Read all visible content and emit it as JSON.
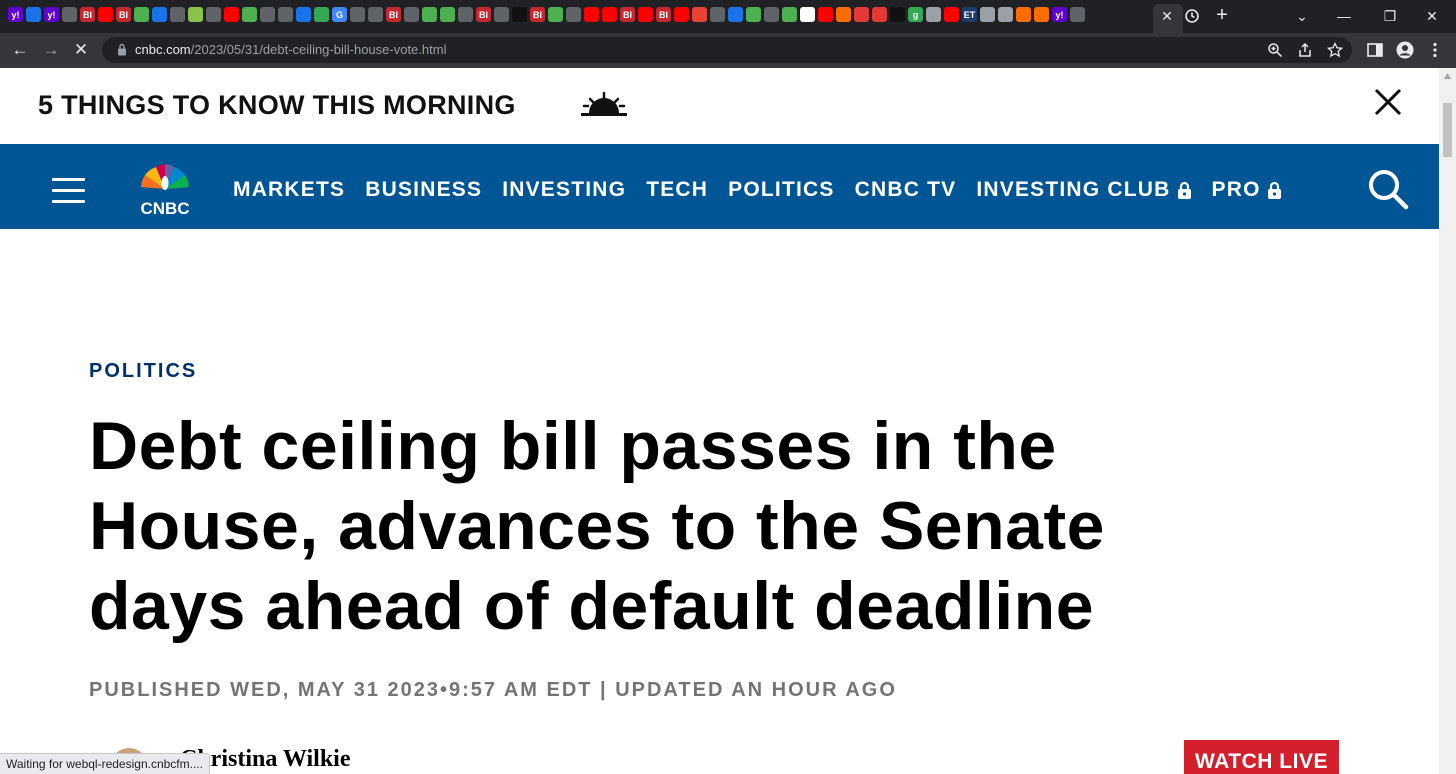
{
  "browser": {
    "tab_icons": [
      {
        "icon": "yahoo-icon",
        "label": "y!",
        "color": "#6001d2"
      },
      {
        "icon": "shield-icon",
        "label": "",
        "color": "#1a73e8"
      },
      {
        "icon": "yahoo-icon",
        "label": "y!",
        "color": "#6001d2"
      },
      {
        "icon": "paper-icon",
        "label": "",
        "color": "#5f6368"
      },
      {
        "icon": "business-insider-icon",
        "label": "BI",
        "color": "#c5282f"
      },
      {
        "icon": "youtube-icon",
        "label": "",
        "color": "#ff0000"
      },
      {
        "icon": "business-insider-icon",
        "label": "BI",
        "color": "#c5282f"
      },
      {
        "icon": "play-icon",
        "label": "",
        "color": "#4caf50"
      },
      {
        "icon": "shield-icon",
        "label": "",
        "color": "#1a73e8"
      },
      {
        "icon": "play-icon",
        "label": "",
        "color": "#5f6368"
      },
      {
        "icon": "map-icon",
        "label": "",
        "color": "#8bc34a"
      },
      {
        "icon": "globe-icon",
        "label": "",
        "color": "#5f6368"
      },
      {
        "icon": "youtube-icon",
        "label": "",
        "color": "#ff0000"
      },
      {
        "icon": "play-icon",
        "label": "",
        "color": "#4caf50"
      },
      {
        "icon": "globe-icon",
        "label": "",
        "color": "#5f6368"
      },
      {
        "icon": "play-icon",
        "label": "",
        "color": "#5f6368"
      },
      {
        "icon": "search-icon",
        "label": "",
        "color": "#1a73e8"
      },
      {
        "icon": "doc-icon",
        "label": "",
        "color": "#34a853"
      },
      {
        "icon": "google-icon",
        "label": "G",
        "color": "#4285f4"
      },
      {
        "icon": "paper-icon",
        "label": "",
        "color": "#5f6368"
      },
      {
        "icon": "globe-icon",
        "label": "",
        "color": "#5f6368"
      },
      {
        "icon": "business-insider-icon",
        "label": "BI",
        "color": "#c5282f"
      },
      {
        "icon": "paper-icon",
        "label": "",
        "color": "#5f6368"
      },
      {
        "icon": "play-icon",
        "label": "",
        "color": "#4caf50"
      },
      {
        "icon": "play-icon",
        "label": "",
        "color": "#4caf50"
      },
      {
        "icon": "play-icon",
        "label": "",
        "color": "#5f6368"
      },
      {
        "icon": "business-insider-icon",
        "label": "BI",
        "color": "#c5282f"
      },
      {
        "icon": "paper-icon",
        "label": "",
        "color": "#5f6368"
      },
      {
        "icon": "dark-icon",
        "label": "",
        "color": "#111111"
      },
      {
        "icon": "business-insider-icon",
        "label": "BI",
        "color": "#c5282f"
      },
      {
        "icon": "play-icon",
        "label": "",
        "color": "#4caf50"
      },
      {
        "icon": "play-icon",
        "label": "",
        "color": "#5f6368"
      },
      {
        "icon": "youtube-icon",
        "label": "",
        "color": "#ff0000"
      },
      {
        "icon": "youtube-icon",
        "label": "",
        "color": "#ff0000"
      },
      {
        "icon": "business-insider-icon",
        "label": "BI",
        "color": "#c5282f"
      },
      {
        "icon": "youtube-icon",
        "label": "",
        "color": "#ff0000"
      },
      {
        "icon": "business-insider-icon",
        "label": "BI",
        "color": "#c5282f"
      },
      {
        "icon": "youtube-icon",
        "label": "",
        "color": "#ff0000"
      },
      {
        "icon": "news-icon",
        "label": "",
        "color": "#ea4335"
      },
      {
        "icon": "globe-icon",
        "label": "",
        "color": "#5f6368"
      },
      {
        "icon": "search-icon",
        "label": "",
        "color": "#1a73e8"
      },
      {
        "icon": "play-icon",
        "label": "",
        "color": "#4caf50"
      },
      {
        "icon": "globe-icon",
        "label": "",
        "color": "#5f6368"
      },
      {
        "icon": "play-icon",
        "label": "",
        "color": "#4caf50"
      },
      {
        "icon": "wsj-icon",
        "label": "",
        "color": "#ffffff"
      },
      {
        "icon": "youtube-icon",
        "label": "",
        "color": "#ff0000"
      },
      {
        "icon": "bookmark-icon",
        "label": "",
        "color": "#ff6d00"
      },
      {
        "icon": "podcast-icon",
        "label": "",
        "color": "#e53935"
      },
      {
        "icon": "podcast-icon",
        "label": "",
        "color": "#e53935"
      },
      {
        "icon": "dark-icon",
        "label": "",
        "color": "#111111"
      },
      {
        "icon": "g-icon",
        "label": "g",
        "color": "#34a853"
      },
      {
        "icon": "avatar-icon",
        "label": "",
        "color": "#9aa0a6"
      },
      {
        "icon": "youtube-icon",
        "label": "",
        "color": "#ff0000"
      },
      {
        "icon": "et-icon",
        "label": "ET",
        "color": "#1a3c6e"
      },
      {
        "icon": "avatar-icon",
        "label": "",
        "color": "#9aa0a6"
      },
      {
        "icon": "avatar-icon",
        "label": "",
        "color": "#9aa0a6"
      },
      {
        "icon": "bookmark-icon",
        "label": "",
        "color": "#ff6d00"
      },
      {
        "icon": "bookmark-icon",
        "label": "",
        "color": "#ff6d00"
      },
      {
        "icon": "yahoo-icon",
        "label": "y!",
        "color": "#6001d2"
      },
      {
        "icon": "paper-icon",
        "label": "",
        "color": "#5f6368"
      }
    ],
    "url_host": "cnbc.com",
    "url_path": "/2023/05/31/debt-ceiling-bill-house-vote.html",
    "status_text": "Waiting for webql-redesign.cnbcfm...."
  },
  "promo": {
    "text": "5 THINGS TO KNOW THIS MORNING"
  },
  "nav": {
    "logo_text": "CNBC",
    "links": [
      "MARKETS",
      "BUSINESS",
      "INVESTING",
      "TECH",
      "POLITICS",
      "CNBC TV"
    ],
    "locked_links": [
      "INVESTING CLUB",
      "PRO"
    ],
    "brand_color": "#005594"
  },
  "article": {
    "eyebrow": "POLITICS",
    "headline": "Debt ceiling bill passes in the House, advances to the Senate days ahead of default deadline",
    "timestamp": "PUBLISHED WED, MAY 31 2023•9:57 AM EDT | UPDATED AN HOUR AGO",
    "author": "Christina Wilkie",
    "watch_live": "WATCH LIVE"
  }
}
